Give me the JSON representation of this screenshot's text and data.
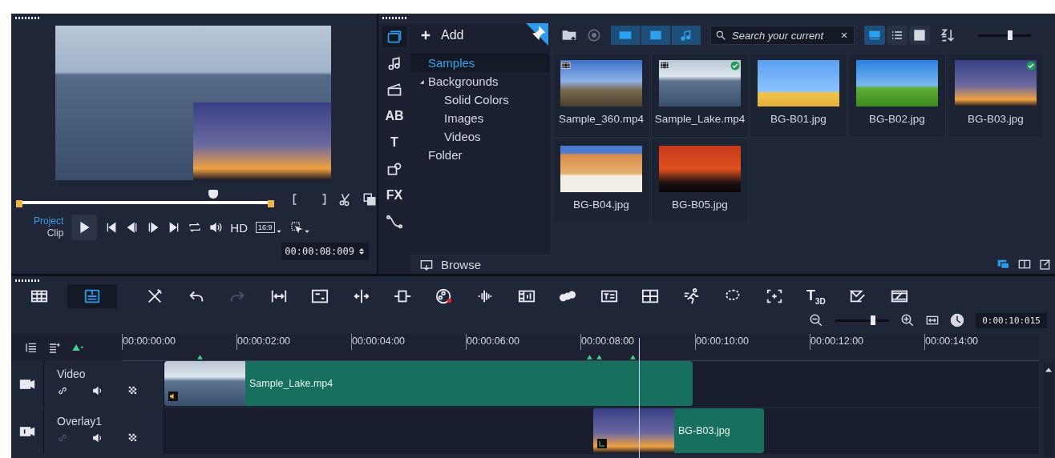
{
  "player": {
    "scrubber": {
      "level": 0.77
    },
    "modes": [
      {
        "label": "Project",
        "selected": true
      },
      {
        "label": "Clip",
        "selected": false
      }
    ],
    "hd": "HD",
    "aspect": "16:9",
    "timecode": "00:00:08:009"
  },
  "library": {
    "categories": [
      {
        "kind": "media",
        "selected": true
      },
      {
        "kind": "audio",
        "selected": false
      },
      {
        "kind": "transition",
        "selected": false
      },
      {
        "kind": "glyph",
        "glyph": "AB",
        "selected": false
      },
      {
        "kind": "glyph",
        "glyph": "T",
        "selected": false
      },
      {
        "kind": "graphics",
        "selected": false
      },
      {
        "kind": "glyph",
        "glyph": "FX",
        "selected": false
      },
      {
        "kind": "path",
        "selected": false
      }
    ],
    "add": "Add",
    "tree": [
      {
        "label": "Samples",
        "selected": true
      },
      {
        "label": "Backgrounds",
        "selected": false,
        "expanded": true,
        "children": [
          {
            "label": "Solid Colors",
            "selected": false
          },
          {
            "label": "Images",
            "selected": false
          },
          {
            "label": "Videos",
            "selected": false
          }
        ]
      },
      {
        "label": "Folder",
        "selected": false
      }
    ],
    "browse": "Browse",
    "search": {
      "placeholder": "Search your current"
    },
    "views": [
      {
        "kind": "large",
        "selected": true
      },
      {
        "kind": "list",
        "selected": false
      },
      {
        "kind": "grid",
        "selected": false
      }
    ],
    "thumb_size": {
      "level": 0.6
    },
    "media": [
      {
        "name": "Sample_360.mp4",
        "kind": "video",
        "checked": false
      },
      {
        "name": "Sample_Lake.mp4",
        "kind": "video",
        "checked": true
      },
      {
        "name": "BG-B01.jpg",
        "kind": "image",
        "checked": false
      },
      {
        "name": "BG-B02.jpg",
        "kind": "image",
        "checked": false
      },
      {
        "name": "BG-B03.jpg",
        "kind": "image",
        "checked": true
      },
      {
        "name": "BG-B04.jpg",
        "kind": "image",
        "checked": false
      },
      {
        "name": "BG-B05.jpg",
        "kind": "image",
        "checked": false
      }
    ]
  },
  "timeline": {
    "views": [
      {
        "kind": "storyboard",
        "selected": false
      },
      {
        "kind": "timeline",
        "selected": true
      }
    ],
    "tools": [
      {
        "kind": "tools",
        "disabled": false
      },
      {
        "kind": "undo",
        "disabled": false
      },
      {
        "kind": "redo",
        "disabled": true
      },
      {
        "kind": "fit",
        "disabled": false
      },
      {
        "kind": "crop",
        "disabled": false
      },
      {
        "kind": "split",
        "disabled": false
      },
      {
        "kind": "resize",
        "disabled": false
      },
      {
        "kind": "reel",
        "disabled": false
      },
      {
        "kind": "wave",
        "disabled": false
      },
      {
        "kind": "filmaudio",
        "disabled": false
      },
      {
        "kind": "circles",
        "disabled": false
      },
      {
        "kind": "titlebox",
        "disabled": false
      },
      {
        "kind": "grid",
        "disabled": false
      },
      {
        "kind": "runner",
        "disabled": false
      },
      {
        "kind": "lasso",
        "disabled": false
      },
      {
        "kind": "frameplus",
        "disabled": false
      },
      {
        "kind": "glyph",
        "glyph": "T$_{3D}$",
        "disabled": false
      },
      {
        "kind": "pen",
        "disabled": false
      },
      {
        "kind": "filmedit",
        "disabled": false
      }
    ],
    "zoom": {
      "level": 0.7
    },
    "duration": "0:00:10:015",
    "ruler": [
      "00:00:00:00",
      "00:00:02:00",
      "00:00:04:00",
      "00:00:06:00",
      "00:00:08:00",
      "00:00:10:00",
      "00:00:12:00",
      "00:00:14:00"
    ],
    "tracks": [
      {
        "name": "Video",
        "kind": "video",
        "link_enabled": true,
        "clips": [
          {
            "name": "Sample_Lake.mp4"
          }
        ]
      },
      {
        "name": "Overlay1",
        "kind": "overlay",
        "link_enabled": false,
        "clips": [
          {
            "name": "BG-B03.jpg"
          }
        ]
      }
    ]
  }
}
